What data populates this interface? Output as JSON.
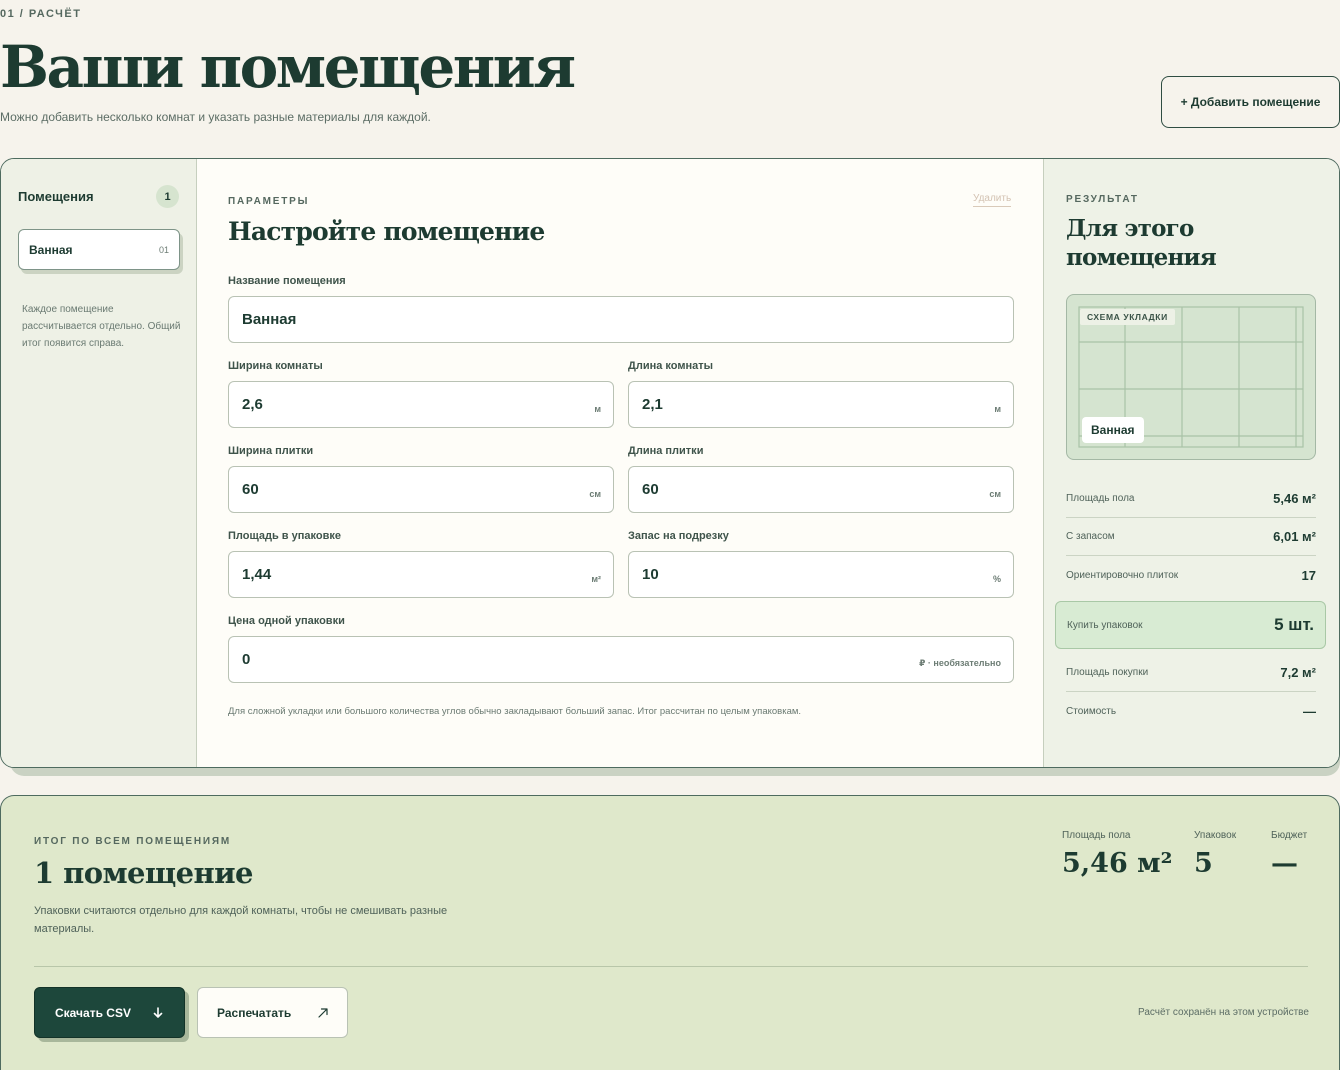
{
  "header": {
    "eyebrow": "01 / РАСЧЁТ",
    "title": "Ваши помещения",
    "subtitle": "Можно добавить несколько комнат и указать разные материалы для каждой.",
    "add_room_label": "+ Добавить помещение"
  },
  "sidebar": {
    "title": "Помещения",
    "count": "1",
    "items": [
      {
        "name": "Ванная",
        "number": "01"
      }
    ],
    "note": "Каждое помещение рассчитывается отдельно. Общий итог появится справа."
  },
  "form": {
    "eyebrow": "ПАРАМЕТРЫ",
    "delete_label": "Удалить",
    "title": "Настройте помещение",
    "fields": {
      "room_name": {
        "label": "Название помещения",
        "value": "Ванная"
      },
      "room_width": {
        "label": "Ширина комнаты",
        "value": "2,6",
        "unit": "м"
      },
      "room_length": {
        "label": "Длина комнаты",
        "value": "2,1",
        "unit": "м"
      },
      "tile_width": {
        "label": "Ширина плитки",
        "value": "60",
        "unit": "см"
      },
      "tile_length": {
        "label": "Длина плитки",
        "value": "60",
        "unit": "см"
      },
      "pack_area": {
        "label": "Площадь в упаковке",
        "value": "1,44",
        "unit": "м²"
      },
      "cut_reserve": {
        "label": "Запас на подрезку",
        "value": "10",
        "unit": "%"
      },
      "pack_price": {
        "label": "Цена одной упаковки",
        "value": "0",
        "unit": "₽ · необязательно"
      }
    },
    "note": "Для сложной укладки или большого количества углов обычно закладывают больший запас. Итог рассчитан по целым упаковкам."
  },
  "result": {
    "eyebrow": "РЕЗУЛЬТАТ",
    "title": "Для этого помещения",
    "scheme_label": "СХЕМА УКЛАДКИ",
    "scheme_room": "Ванная",
    "metrics": {
      "floor_area": {
        "label": "Площадь пола",
        "value": "5,46 м²"
      },
      "with_reserve": {
        "label": "С запасом",
        "value": "6,01 м²"
      },
      "tiles": {
        "label": "Ориентировочно плиток",
        "value": "17"
      },
      "packs": {
        "label": "Купить упаковок",
        "value": "5 шт."
      },
      "purchase_area": {
        "label": "Площадь покупки",
        "value": "7,2 м²"
      },
      "cost": {
        "label": "Стоимость",
        "value": "—"
      }
    }
  },
  "totals": {
    "eyebrow": "ИТОГ ПО ВСЕМ ПОМЕЩЕНИЯМ",
    "title": "1 помещение",
    "note": "Упаковки считаются отдельно для каждой комнаты, чтобы не смешивать разные материалы.",
    "stats": {
      "floor_area": {
        "label": "Площадь пола",
        "value": "5,46 м²"
      },
      "packs": {
        "label": "Упаковок",
        "value": "5"
      },
      "budget": {
        "label": "Бюджет",
        "value": "—"
      }
    },
    "csv_label": "Скачать CSV",
    "print_label": "Распечатать",
    "saved_note": "Расчёт сохранён на этом устройстве"
  },
  "colors": {
    "brand_dark": "#1d473b",
    "background": "#f6f3ec",
    "result_panel": "#eef2e7",
    "totals_panel": "#dfe8cb",
    "highlight": "#d8ebd3"
  }
}
